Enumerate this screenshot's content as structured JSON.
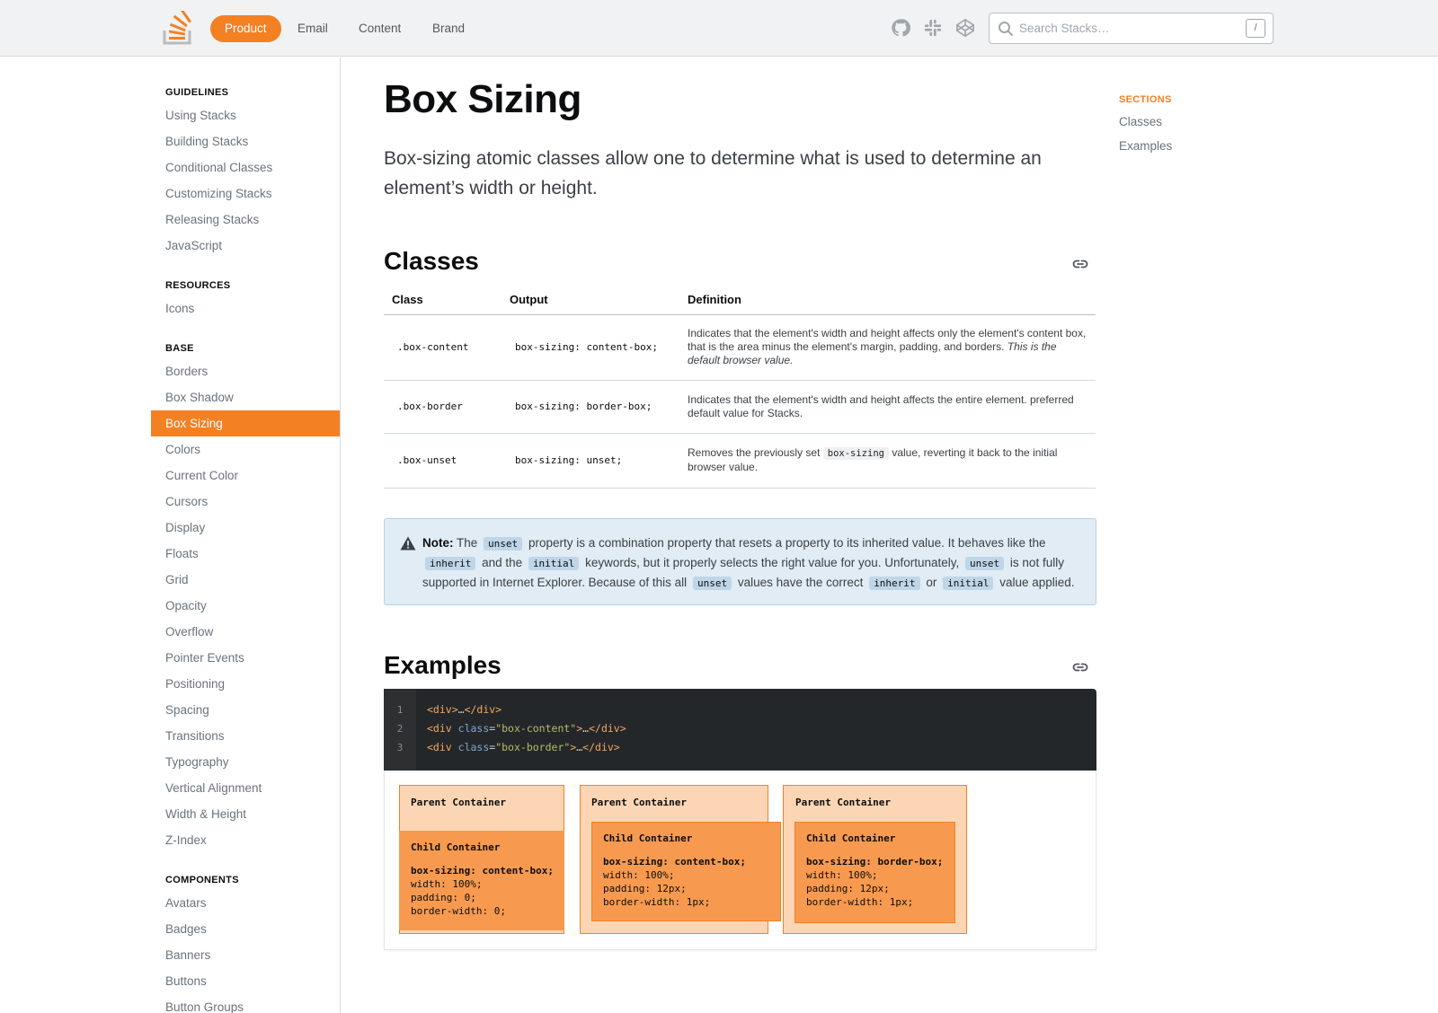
{
  "header": {
    "nav": [
      "Product",
      "Email",
      "Content",
      "Brand"
    ],
    "icons": [
      "github-icon",
      "slack-icon",
      "codepen-icon"
    ],
    "search_placeholder": "Search Stacks…",
    "search_shortcut": "/"
  },
  "sidebar": {
    "sections": [
      {
        "heading": "GUIDELINES",
        "items": [
          "Using Stacks",
          "Building Stacks",
          "Conditional Classes",
          "Customizing Stacks",
          "Releasing Stacks",
          "JavaScript"
        ]
      },
      {
        "heading": "RESOURCES",
        "items": [
          "Icons"
        ]
      },
      {
        "heading": "BASE",
        "items": [
          "Borders",
          "Box Shadow",
          "Box Sizing",
          "Colors",
          "Current Color",
          "Cursors",
          "Display",
          "Floats",
          "Grid",
          "Opacity",
          "Overflow",
          "Pointer Events",
          "Positioning",
          "Spacing",
          "Transitions",
          "Typography",
          "Vertical Alignment",
          "Width & Height",
          "Z-Index"
        ]
      },
      {
        "heading": "COMPONENTS",
        "items": [
          "Avatars",
          "Badges",
          "Banners",
          "Buttons",
          "Button Groups"
        ]
      }
    ],
    "active_item": "Box Sizing"
  },
  "page": {
    "title": "Box Sizing",
    "description": "Box-sizing atomic classes allow one to determine what is used to determine an element’s width or height."
  },
  "toc": {
    "heading": "SECTIONS",
    "items": [
      "Classes",
      "Examples"
    ]
  },
  "classes": {
    "heading": "Classes",
    "columns": [
      "Class",
      "Output",
      "Definition"
    ],
    "rows": [
      {
        "class": ".box-content",
        "output": "box-sizing: content-box;",
        "definition": "Indicates that the element's width and height affects only the element's content box, that is the area minus the element's margin, padding, and borders.",
        "definition_italic": "This is the default browser value."
      },
      {
        "class": ".box-border",
        "output": "box-sizing: border-box;",
        "definition": "Indicates that the element's width and height affects the entire element. preferred default value for Stacks."
      },
      {
        "class": ".box-unset",
        "output": "box-sizing: unset;",
        "definition_pre": "Removes the previously set",
        "definition_code": "box-sizing",
        "definition_post": "value, reverting it back to the initial browser value."
      }
    ]
  },
  "note": {
    "label": "Note:",
    "t1": "The",
    "c1": "unset",
    "t2": "property is a combination property that resets a property to its inherited value. It behaves like the",
    "c2": "inherit",
    "t3": "and the",
    "c3": "initial",
    "t4": "keywords, but it properly selects the right value for you. Unfortunately,",
    "c4": "unset",
    "t5": "is not fully supported in Internet Explorer. Because of this all",
    "c5": "unset",
    "t6": "values have the correct",
    "c6": "inherit",
    "t7": "or",
    "c7": "initial",
    "t8": "value applied."
  },
  "examples": {
    "heading": "Examples",
    "code": {
      "line_numbers": [
        "1",
        "2",
        "3"
      ],
      "l1_open": "<div>",
      "l1_ell": "…",
      "l1_close": "</div>",
      "l2_open": "<div",
      "l2_attr": "class",
      "l2_eq": "=",
      "l2_val": "\"box-content\"",
      "l2_gt": ">",
      "l2_ell": "…",
      "l2_close": "</div>",
      "l3_open": "<div",
      "l3_attr": "class",
      "l3_eq": "=",
      "l3_val": "\"box-border\"",
      "l3_gt": ">",
      "l3_ell": "…",
      "l3_close": "</div>"
    },
    "boxes": [
      {
        "parent": "Parent Container",
        "child": "Child Container",
        "lines": [
          "box-sizing: content-box;",
          "width: 100%;",
          "padding: 0;",
          "border-width: 0;"
        ]
      },
      {
        "parent": "Parent Container",
        "child": "Child Container",
        "lines": [
          "box-sizing: content-box;",
          "width: 100%;",
          "padding: 12px;",
          "border-width: 1px;"
        ]
      },
      {
        "parent": "Parent Container",
        "child": "Child Container",
        "lines": [
          "box-sizing: border-box;",
          "width: 100%;",
          "padding: 12px;",
          "border-width: 1px;"
        ]
      }
    ]
  },
  "colors": {
    "accent": "#f48024",
    "note_bg": "#e1ecf4",
    "code_bg": "#242729"
  }
}
